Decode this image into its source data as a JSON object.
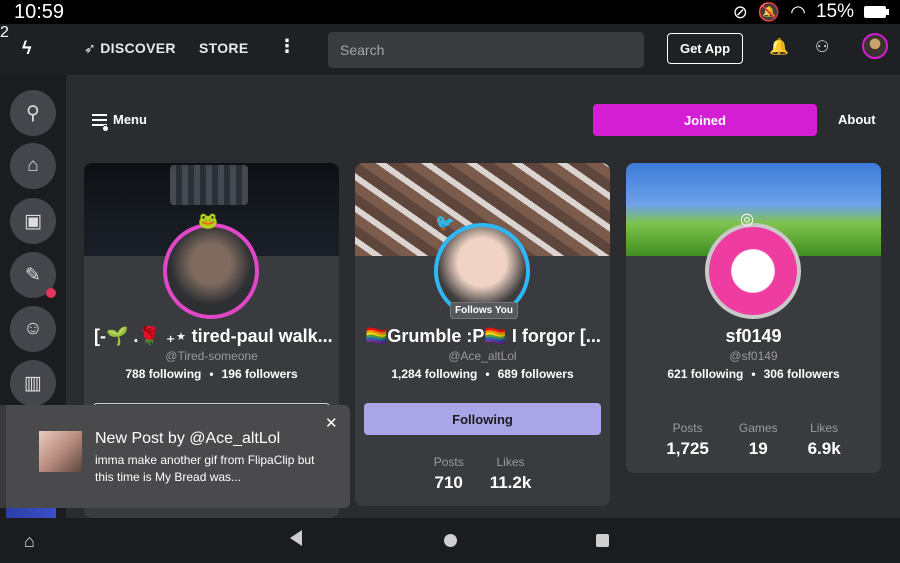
{
  "status_bar": {
    "time": "10:59",
    "notification_count": "2",
    "battery": "15%"
  },
  "topnav": {
    "discover": "DISCOVER",
    "store": "STORE",
    "more": "⋮",
    "search_placeholder": "Search",
    "get_app": "Get App"
  },
  "community_header": {
    "menu": "Menu",
    "joined": "Joined",
    "about": "About"
  },
  "cards": [
    {
      "name": "[-🌱 .🌹 ₊⋆ tired-paul walk...",
      "handle": "@Tired-someone",
      "following": "788 following",
      "followers": "196 followers"
    },
    {
      "name": "🏳️‍🌈Grumble :P🏳️‍🌈 I forgor [...",
      "handle": "@Ace_altLol",
      "following": "1,284 following",
      "followers": "689 followers",
      "follows_you": "Follows You",
      "button": "Following",
      "stats": [
        {
          "label": "Posts",
          "value": "710"
        },
        {
          "label": "Likes",
          "value": "11.2k"
        }
      ]
    },
    {
      "name": "sf0149",
      "handle": "@sf0149",
      "following": "621 following",
      "followers": "306 followers",
      "stats": [
        {
          "label": "Posts",
          "value": "1,725"
        },
        {
          "label": "Games",
          "value": "19"
        },
        {
          "label": "Likes",
          "value": "6.9k"
        }
      ]
    }
  ],
  "toast": {
    "title": "New Post by @Ace_altLol",
    "body": "imma make another gif from FlipaClip but this time is My Bread was..."
  },
  "colors": {
    "accent": "#d41ed4",
    "following_button": "#a9a5e6",
    "card_bg": "#3a3b3f",
    "page_bg": "#2b2c30"
  }
}
